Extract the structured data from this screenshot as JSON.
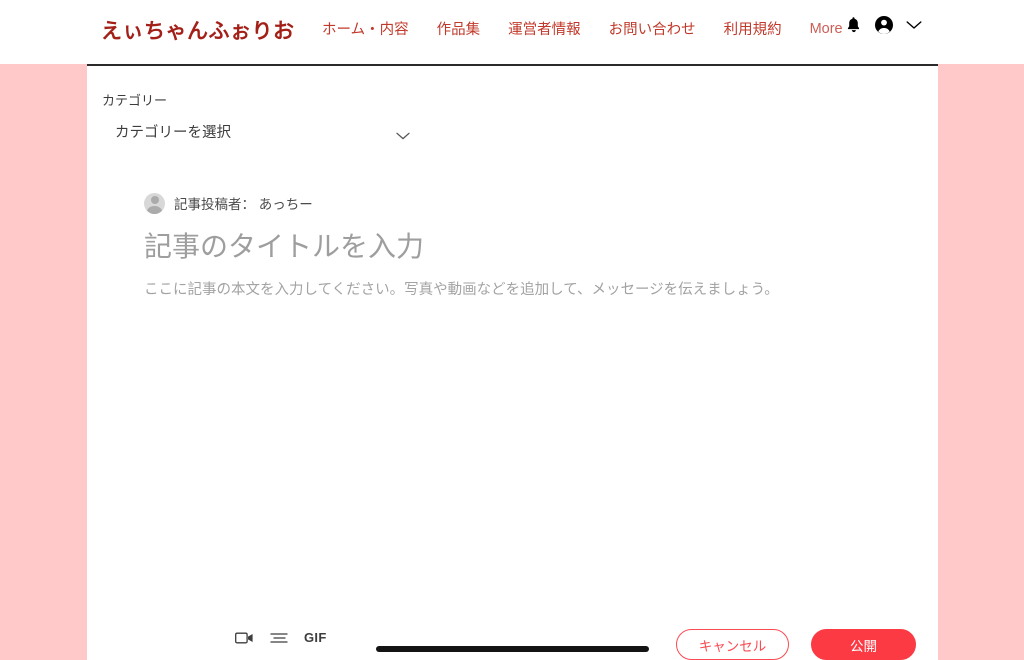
{
  "site": {
    "logo": "えぃちゃんふぉりお",
    "nav": [
      {
        "label": "ホーム・内容",
        "name": "nav-home"
      },
      {
        "label": "作品集",
        "name": "nav-works"
      },
      {
        "label": "運営者情報",
        "name": "nav-about"
      },
      {
        "label": "お問い合わせ",
        "name": "nav-contact"
      },
      {
        "label": "利用規約",
        "name": "nav-terms"
      },
      {
        "label": "More",
        "name": "nav-more"
      }
    ],
    "icons": {
      "notifications": "bell-icon",
      "account": "account-avatar-icon",
      "expand": "chevron-down-icon"
    }
  },
  "category": {
    "label": "カテゴリー",
    "selected": "カテゴリーを選択",
    "chevron": "chevron-down-icon"
  },
  "editor": {
    "author_line": "記事投稿者： あっちー",
    "avatar": "default-avatar-icon",
    "title_placeholder": "記事のタイトルを入力",
    "body_placeholder": "ここに記事の本文を入力してください。写真や動画などを追加して、メッセージを伝えましょう。",
    "toolbar": [
      {
        "name": "video-icon",
        "label": ""
      },
      {
        "name": "divider-lines-icon",
        "label": ""
      },
      {
        "name": "gif-icon",
        "label": "GIF"
      }
    ]
  },
  "actions": {
    "cancel_label": "キャンセル",
    "publish_label": "公開"
  },
  "colors": {
    "page_background": "#ffc9c9",
    "logo": "#a32019",
    "nav_link": "#c0392b",
    "publish_button": "#fb3a44",
    "cancel_border": "#fb4a52",
    "panel": "#ffffff"
  }
}
